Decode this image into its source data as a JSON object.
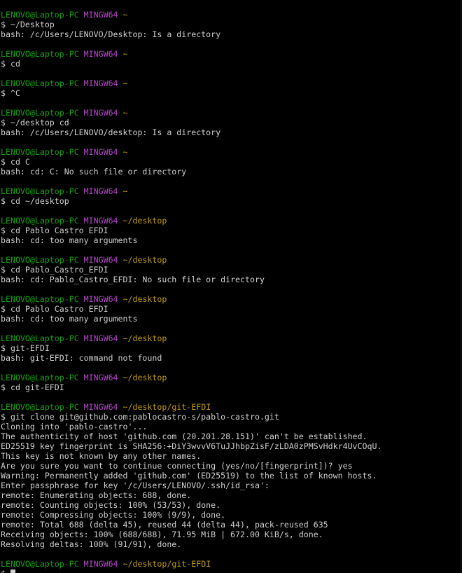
{
  "prompt": {
    "user_host": "LENOVO@Laptop-PC",
    "shell": "MINGW64"
  },
  "lines": [
    {
      "kind": "prompt",
      "path": "~"
    },
    {
      "kind": "text",
      "text": "$ ~/Desktop"
    },
    {
      "kind": "text",
      "text": "bash: /c/Users/LENOVO/Desktop: Is a directory"
    },
    {
      "kind": "blank"
    },
    {
      "kind": "prompt",
      "path": "~"
    },
    {
      "kind": "text",
      "text": "$ cd"
    },
    {
      "kind": "blank"
    },
    {
      "kind": "prompt",
      "path": "~"
    },
    {
      "kind": "text",
      "text": "$ ^C"
    },
    {
      "kind": "blank"
    },
    {
      "kind": "prompt",
      "path": "~"
    },
    {
      "kind": "text",
      "text": "$ ~/desktop cd"
    },
    {
      "kind": "text",
      "text": "bash: /c/Users/LENOVO/desktop: Is a directory"
    },
    {
      "kind": "blank"
    },
    {
      "kind": "prompt",
      "path": "~"
    },
    {
      "kind": "text",
      "text": "$ cd C"
    },
    {
      "kind": "text",
      "text": "bash: cd: C: No such file or directory"
    },
    {
      "kind": "blank"
    },
    {
      "kind": "prompt",
      "path": "~"
    },
    {
      "kind": "text",
      "text": "$ cd ~/desktop"
    },
    {
      "kind": "blank"
    },
    {
      "kind": "prompt",
      "path": "~/desktop"
    },
    {
      "kind": "text",
      "text": "$ cd Pablo Castro EFDI"
    },
    {
      "kind": "text",
      "text": "bash: cd: too many arguments"
    },
    {
      "kind": "blank"
    },
    {
      "kind": "prompt",
      "path": "~/desktop"
    },
    {
      "kind": "text",
      "text": "$ cd Pablo_Castro_EFDI"
    },
    {
      "kind": "text",
      "text": "bash: cd: Pablo_Castro_EFDI: No such file or directory"
    },
    {
      "kind": "blank"
    },
    {
      "kind": "prompt",
      "path": "~/desktop"
    },
    {
      "kind": "text",
      "text": "$ cd Pablo Castro EFDI"
    },
    {
      "kind": "text",
      "text": "bash: cd: too many arguments"
    },
    {
      "kind": "blank"
    },
    {
      "kind": "prompt",
      "path": "~/desktop"
    },
    {
      "kind": "text",
      "text": "$ git-EFDI"
    },
    {
      "kind": "text",
      "text": "bash: git-EFDI: command not found"
    },
    {
      "kind": "blank"
    },
    {
      "kind": "prompt",
      "path": "~/desktop"
    },
    {
      "kind": "text",
      "text": "$ cd git-EFDI"
    },
    {
      "kind": "blank"
    },
    {
      "kind": "prompt",
      "path": "~/desktop/git-EFDI"
    },
    {
      "kind": "text",
      "text": "$ git clone git@github.com:pablocastro-s/pablo-castro.git"
    },
    {
      "kind": "text",
      "text": "Cloning into 'pablo-castro'..."
    },
    {
      "kind": "text",
      "text": "The authenticity of host 'github.com (20.201.28.151)' can't be established."
    },
    {
      "kind": "text",
      "text": "ED25519 key fingerprint is SHA256:+DiY3wvvV6TuJJhbpZisF/zLDA0zPMSvHdkr4UvCOqU."
    },
    {
      "kind": "text",
      "text": "This key is not known by any other names."
    },
    {
      "kind": "text",
      "text": "Are you sure you want to continue connecting (yes/no/[fingerprint])? yes"
    },
    {
      "kind": "text",
      "text": "Warning: Permanently added 'github.com' (ED25519) to the list of known hosts."
    },
    {
      "kind": "text",
      "text": "Enter passphrase for key '/c/Users/LENOVO/.ssh/id_rsa':"
    },
    {
      "kind": "text",
      "text": "remote: Enumerating objects: 688, done."
    },
    {
      "kind": "text",
      "text": "remote: Counting objects: 100% (53/53), done."
    },
    {
      "kind": "text",
      "text": "remote: Compressing objects: 100% (9/9), done."
    },
    {
      "kind": "text",
      "text": "remote: Total 688 (delta 45), reused 44 (delta 44), pack-reused 635"
    },
    {
      "kind": "text",
      "text": "Receiving objects: 100% (688/688), 71.95 MiB | 672.00 KiB/s, done."
    },
    {
      "kind": "text",
      "text": "Resolving deltas: 100% (91/91), done."
    },
    {
      "kind": "blank"
    },
    {
      "kind": "prompt",
      "path": "~/desktop/git-EFDI"
    },
    {
      "kind": "input",
      "text": "$ "
    }
  ]
}
